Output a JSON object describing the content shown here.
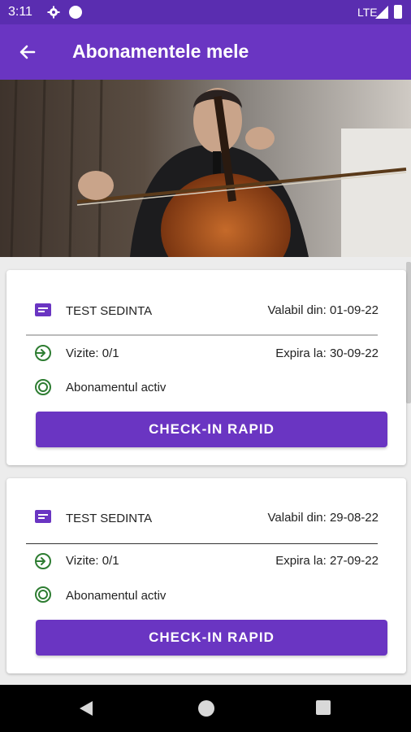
{
  "status_bar": {
    "time": "3:11",
    "network": "LTE"
  },
  "app_bar": {
    "title": "Abonamentele mele"
  },
  "colors": {
    "primary": "#6a35c2",
    "status_bar": "#5a2db0",
    "success_green": "#2e7d32"
  },
  "icons": {
    "back": "arrow-left-icon",
    "subscription": "card-icon",
    "visits": "login-arrow-icon",
    "status": "target-icon"
  },
  "subscriptions": [
    {
      "name": "TEST SEDINTA",
      "valid_from": "Valabil din: 01-09-22",
      "visits": "Vizite: 0/1",
      "expires": "Expira la: 30-09-22",
      "status": "Abonamentul activ",
      "button": "CHECK-IN RAPID"
    },
    {
      "name": "TEST SEDINTA",
      "valid_from": "Valabil din: 29-08-22",
      "visits": "Vizite: 0/1",
      "expires": "Expira la: 27-09-22",
      "status": "Abonamentul activ",
      "button": "CHECK-IN RAPID"
    }
  ]
}
